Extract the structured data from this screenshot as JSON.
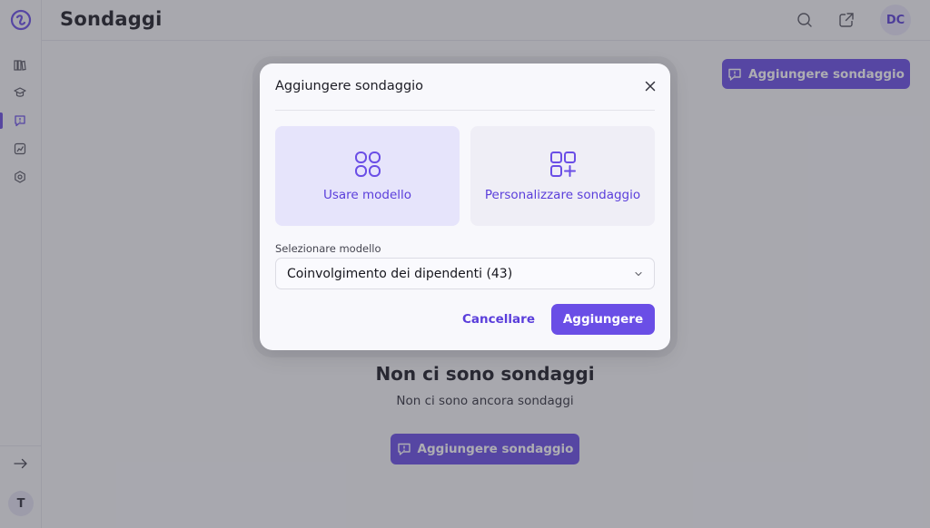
{
  "header": {
    "title": "Sondaggi",
    "user_initials": "DC"
  },
  "sidebar": {
    "items": [
      {
        "icon": "library-icon"
      },
      {
        "icon": "graduation-cap-icon"
      },
      {
        "icon": "survey-icon",
        "active": true
      },
      {
        "icon": "chart-icon"
      },
      {
        "icon": "settings-icon"
      }
    ],
    "user_initial": "T"
  },
  "main": {
    "add_button_label": "Aggiungere sondaggio",
    "empty_title": "Non ci sono sondaggi",
    "empty_subtitle": "Non ci sono ancora sondaggi",
    "empty_add_button_label": "Aggiungere sondaggio"
  },
  "modal": {
    "title": "Aggiungere sondaggio",
    "options": [
      {
        "label": "Usare modello",
        "selected": true
      },
      {
        "label": "Personalizzare sondaggio",
        "selected": false
      }
    ],
    "select_label": "Selezionare modello",
    "select_value": "Coinvolgimento dei dipendenti (43)",
    "cancel_label": "Cancellare",
    "confirm_label": "Aggiungere"
  },
  "colors": {
    "accent": "#6a4ee6",
    "accent_text": "#5a3edb",
    "overlay": "rgba(60,60,72,0.42)"
  }
}
